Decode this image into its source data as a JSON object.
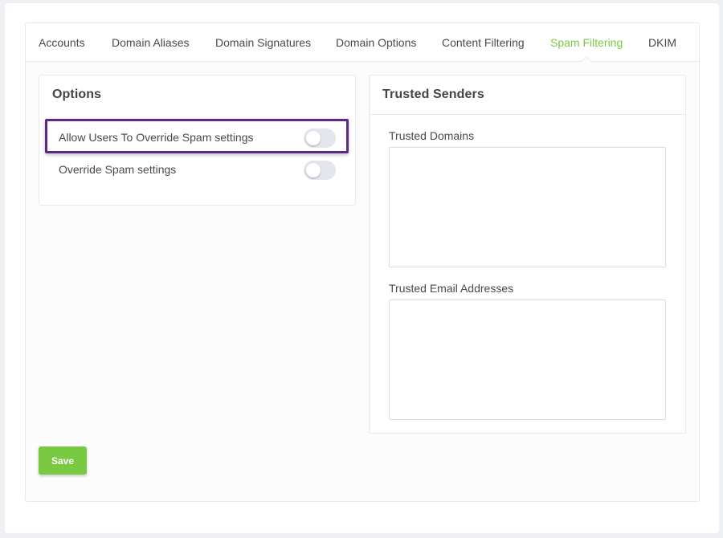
{
  "tabs": [
    {
      "label": "Accounts",
      "active": false
    },
    {
      "label": "Domain Aliases",
      "active": false
    },
    {
      "label": "Domain Signatures",
      "active": false
    },
    {
      "label": "Domain Options",
      "active": false
    },
    {
      "label": "Content Filtering",
      "active": false
    },
    {
      "label": "Spam Filtering",
      "active": true
    },
    {
      "label": "DKIM",
      "active": false
    }
  ],
  "options_card": {
    "title": "Options",
    "items": [
      {
        "label": "Allow Users To Override Spam settings",
        "enabled": false,
        "highlighted": true
      },
      {
        "label": "Override Spam settings",
        "enabled": false,
        "highlighted": false
      }
    ]
  },
  "trusted_card": {
    "title": "Trusted Senders",
    "trusted_domains_label": "Trusted Domains",
    "trusted_domains_value": "",
    "trusted_emails_label": "Trusted Email Addresses",
    "trusted_emails_value": ""
  },
  "save_label": "Save",
  "colors": {
    "accent": "#7ac943",
    "highlight": "#5b2a86",
    "toggle_off": "#e4e5ec"
  }
}
